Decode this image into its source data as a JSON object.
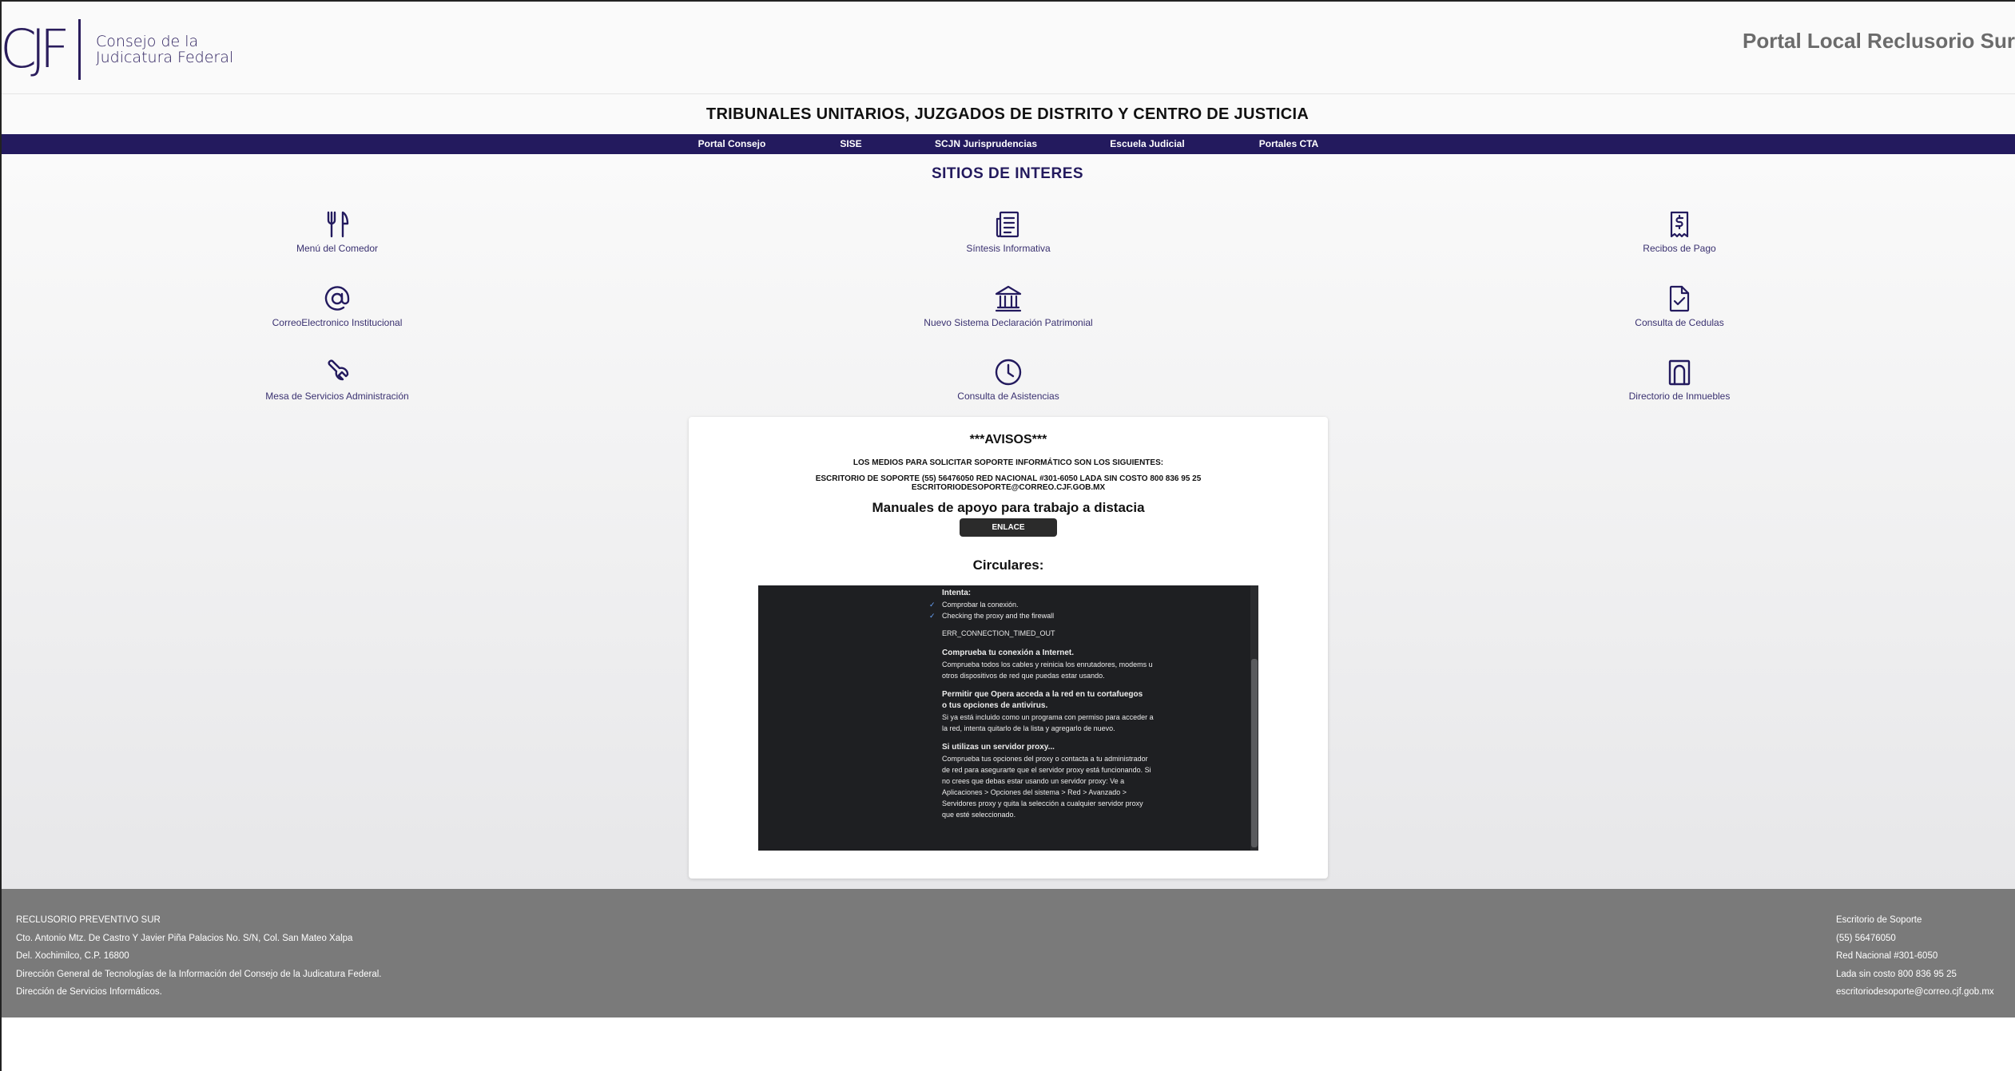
{
  "header": {
    "logo_mark": "CJF",
    "logo_line1": "Consejo de la",
    "logo_line2": "Judicatura Federal",
    "portal_title": "Portal Local Reclusorio Sur"
  },
  "subheader": "TRIBUNALES UNITARIOS, JUZGADOS DE DISTRITO Y CENTRO DE JUSTICIA",
  "nav": {
    "items": [
      {
        "label": "Portal Consejo"
      },
      {
        "label": "SISE"
      },
      {
        "label": "SCJN Jurisprudencias"
      },
      {
        "label": "Escuela Judicial"
      },
      {
        "label": "Portales CTA"
      }
    ]
  },
  "sitios": {
    "title": "SITIOS DE INTERES",
    "items": [
      {
        "label": "Menú del Comedor",
        "icon": "utensils-icon"
      },
      {
        "label": "Síntesis Informativa",
        "icon": "newspaper-icon"
      },
      {
        "label": "Recibos de Pago",
        "icon": "receipt-icon"
      },
      {
        "label": "CorreoElectronico Institucional",
        "icon": "at-icon"
      },
      {
        "label": "Nuevo Sistema Declaración Patrimonial",
        "icon": "bank-icon"
      },
      {
        "label": "Consulta de Cedulas",
        "icon": "file-check-icon"
      },
      {
        "label": "Mesa de Servicios Administración",
        "icon": "wrench-icon"
      },
      {
        "label": "Consulta de Asistencias",
        "icon": "clock-icon"
      },
      {
        "label": "Directorio de Inmuebles",
        "icon": "building-icon"
      }
    ]
  },
  "avisos": {
    "title": "***AVISOS***",
    "medios": "LOS MEDIOS PARA SOLICITAR SOPORTE INFORMÁTICO SON LOS SIGUIENTES:",
    "escritorio_line1": "ESCRITORIO DE SOPORTE (55) 56476050 RED NACIONAL #301-6050 LADA SIN COSTO 800 836 95 25",
    "escritorio_line2": "ESCRITORIODESOPORTE@CORREO.CJF.GOB.MX",
    "manuales": "Manuales de apoyo para trabajo a distacia",
    "enlace": "ENLACE",
    "circulares": "Circulares:"
  },
  "error_page": {
    "intenta": "Intenta:",
    "check1": "Comprobar la conexión.",
    "check2": "Checking the proxy and the firewall",
    "code": "ERR_CONNECTION_TIMED_OUT",
    "h1": "Comprueba tu conexión a Internet.",
    "p1a": "Comprueba todos los cables y reinicia los enrutadores, modems u",
    "p1b": "otros dispositivos de red que puedas estar usando.",
    "h2a": "Permitir que Opera acceda a la red en tu cortafuegos",
    "h2b": "o tus opciones de antivirus.",
    "p2a": "Si ya está incluido como un programa con permiso para acceder a",
    "p2b": "la red, intenta quitarlo de la lista y agregarlo de nuevo.",
    "h3": "Si utilizas un servidor proxy...",
    "p3a": "Comprueba tus opciones del proxy o contacta a tu administrador",
    "p3b": "de red para asegurarte que el servidor proxy está funcionando. Si",
    "p3c": "no crees que debas estar usando un servidor proxy: Ve a",
    "p3d": "Aplicaciones > Opciones del sistema > Red > Avanzado >",
    "p3e": "Servidores proxy y quita la selección a cualquier servidor proxy",
    "p3f": "que esté seleccionado."
  },
  "footer": {
    "left": [
      "RECLUSORIO PREVENTIVO SUR",
      "Cto. Antonio Mtz. De Castro Y Javier Piña Palacios No. S/N, Col. San Mateo Xalpa",
      "Del. Xochimilco, C.P. 16800",
      "Dirección General de Tecnologías de la Información del Consejo de la Judicatura Federal.",
      "Dirección de Servicios Informáticos."
    ],
    "right": [
      "Escritorio de Soporte",
      "(55) 56476050",
      "Red Nacional #301-6050",
      "Lada sin costo 800 836 95 25",
      "escritoriodesoporte@correo.cjf.gob.mx"
    ]
  },
  "colors": {
    "brand": "#231a5e",
    "footer_bg": "#7a7a7a",
    "error_bg": "#1e1f22"
  }
}
